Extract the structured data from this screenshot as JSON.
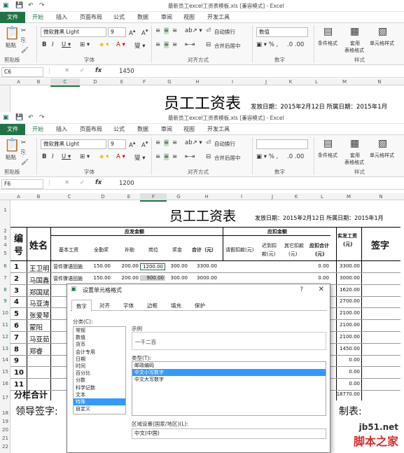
{
  "window_title_1": "最新员工excel工资表模板.xls  [兼容模式] - Excel",
  "window_title_2": "最新员工excel工资表模板.xls  [兼容模式] - Excel",
  "tabs": [
    "文件",
    "开始",
    "插入",
    "页面布局",
    "公式",
    "数据",
    "审阅",
    "视图",
    "开发工具"
  ],
  "ribbon": {
    "font_name": "微软雅黑 Light",
    "font_size": "9",
    "wrap_text": "自动换行",
    "merge_center": "合并后居中",
    "number_format": "数值",
    "paste": "粘贴",
    "conditional_format": "条件格式",
    "table_format_1": "套用",
    "table_format_2": "表格格式",
    "cell_style": "单元格样式",
    "groups": {
      "clipboard": "剪贴板",
      "font": "字体",
      "alignment": "对齐方式",
      "number": "数字",
      "styles": "样式"
    }
  },
  "pane1": {
    "name_box": "C6",
    "formula": "1450"
  },
  "pane2": {
    "name_box": "F6",
    "formula": "1200"
  },
  "columns": [
    "A",
    "B",
    "C",
    "D",
    "E",
    "F",
    "G",
    "H",
    "I",
    "J",
    "K",
    "L",
    "M",
    "N"
  ],
  "sheet": {
    "title": "员工工资表",
    "issue_date": "发放日期：2015年2月12日 所属日期：2015年1月",
    "header_no_1": "编",
    "header_no_2": "号",
    "header_name": "姓名",
    "header_payable": "应发金额",
    "header_deduct": "应扣金额",
    "header_actual_1": "实发工资",
    "header_actual_2": "(元)",
    "header_sign": "签字",
    "sub_headers": {
      "base": "基本工资",
      "perf": "全勤奖",
      "subsidy": "补助",
      "post": "岗位",
      "bonus": "奖金",
      "total": "合计（元）",
      "leave": "请假扣款(元)",
      "late_1": "迟到扣",
      "late_2": "款(元)",
      "other_1": "其它扣款",
      "other_2": "(元)",
      "deduct_total": "应扣合计",
      "deduct_total_2": "(元)"
    },
    "rows": [
      {
        "row": "6",
        "no": "1",
        "name": "王卫明",
        "base": "营件骤语回施",
        "perf": "150.00",
        "subsidy": "200.00",
        "post": "1200.00",
        "bonus": "300.00",
        "total": "3300.00",
        "deduct": "0.00",
        "actual": "3300.00"
      },
      {
        "row": "7",
        "no": "2",
        "name": "马国鑫",
        "base": "营件骤语回施",
        "perf": "150.00",
        "subsidy": "200.00",
        "post": "900.00",
        "bonus": "300.00",
        "total": "3000.00",
        "deduct": "0.00",
        "actual": "3000.00"
      },
      {
        "row": "8",
        "no": "3",
        "name": "郑国斌",
        "actual": "1620.00"
      },
      {
        "row": "9",
        "no": "4",
        "name": "马亚涛",
        "actual": "2700.00"
      },
      {
        "row": "10",
        "no": "5",
        "name": "张爱琴",
        "actual": "2100.00"
      },
      {
        "row": "11",
        "no": "6",
        "name": "蒙阳",
        "actual": "2100.00"
      },
      {
        "row": "12",
        "no": "7",
        "name": "马亚茹",
        "actual": "2100.00"
      },
      {
        "row": "13",
        "no": "8",
        "name": "郑睿",
        "actual": "1450.00"
      },
      {
        "row": "14",
        "no": "9",
        "actual": "0.00"
      },
      {
        "row": "15",
        "no": "10",
        "actual": "0.00"
      },
      {
        "row": "16",
        "no": "11",
        "actual": "0.00"
      }
    ],
    "subtotal_label": "分栏合计",
    "subtotal_value": "18770.00",
    "leader_sign": "领导签字:",
    "prepared_by": "制表:",
    "row_numbers_top": [
      "1",
      "2",
      "3",
      "4",
      "5"
    ],
    "row_numbers_bottom": [
      "17",
      "18",
      "19",
      "20",
      "21",
      "22"
    ]
  },
  "dialog": {
    "title": "设置单元格格式",
    "help": "?",
    "close": "✕",
    "tabs": [
      "数字",
      "对齐",
      "字体",
      "边框",
      "填充",
      "保护"
    ],
    "category_label": "分类(C):",
    "categories": [
      "常规",
      "数值",
      "货币",
      "会计专用",
      "日期",
      "时间",
      "百分比",
      "分数",
      "科学记数",
      "文本",
      "特殊",
      "自定义"
    ],
    "selected_category": "特殊",
    "sample_label": "示例",
    "sample_value": "一千二百",
    "type_label": "类型(T):",
    "types": [
      "邮政编码",
      "中文小写数字",
      "中文大写数字"
    ],
    "selected_type": "中文小写数字",
    "locale_label": "区域设置(国家/地区)(L):",
    "locale_value": "中文(中国)"
  },
  "watermark": {
    "site": "jb51.net",
    "name": "脚本之家"
  },
  "colors": {
    "excel_green": "#217346",
    "selection_blue": "#3399ff"
  }
}
